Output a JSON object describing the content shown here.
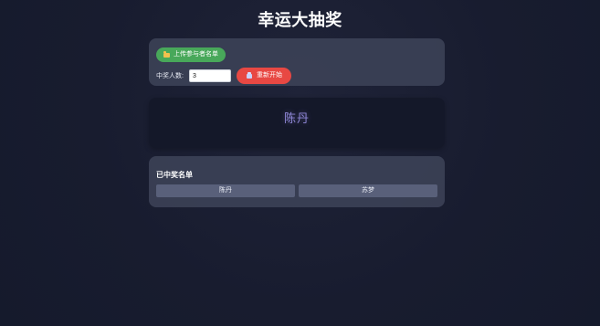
{
  "app": {
    "title": "幸运大抽奖"
  },
  "controls": {
    "upload_label": "上传参与者名单",
    "count_label": "中奖人数:",
    "count_value": "3",
    "restart_label": "重新开始"
  },
  "display": {
    "current_name": "陈丹"
  },
  "winners": {
    "title": "已中奖名单",
    "items": [
      {
        "name": "陈丹"
      },
      {
        "name": "苏梦"
      }
    ]
  },
  "colors": {
    "upload_button": "#48a85a",
    "restart_button": "#e84843",
    "display_name": "#8e86d6"
  },
  "icons": {
    "upload": "folder-icon",
    "restart": "restart-icon"
  }
}
